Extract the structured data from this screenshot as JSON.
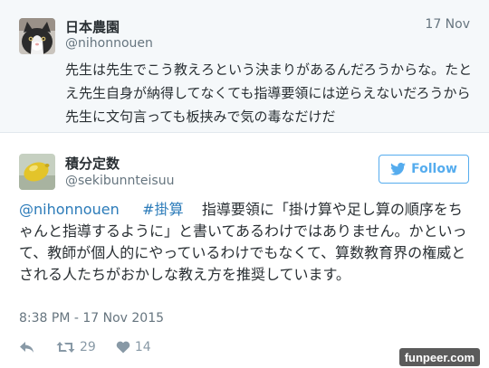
{
  "parent_tweet": {
    "name": "日本農園",
    "handle": "@nihonnouen",
    "date": "17 Nov",
    "text": "先生は先生でこう教えろという決まりがあるんだろうからな。たとえ先生自身が納得してなくても指導要領には逆らえないだろうから先生に文句言っても板挟みで気の毒なだけだ"
  },
  "main_tweet": {
    "name": "積分定数",
    "handle": "@sekibunnteisuu",
    "follow_label": "Follow",
    "mention": "@nihonnouen",
    "hashtag": "#掛算",
    "text": "指導要領に「掛け算や足し算の順序をちゃんと指導するように」と書いてあるわけではありません。かといって、教師が個人的にやっているわけでもなくて、算数教育界の権威とされる人たちがおかしな教え方を推奨しています。",
    "timestamp": "8:38 PM - 17 Nov 2015",
    "retweets": "29",
    "likes": "14"
  },
  "watermark": "funpeer.com",
  "colors": {
    "link": "#2b7bb9",
    "follow": "#55acee",
    "muted": "#66757f",
    "parent_bg": "#f5f8fa"
  },
  "icons": [
    "cat-avatar",
    "bird-logo",
    "reply-icon",
    "retweet-icon",
    "heart-icon",
    "lemon-avatar"
  ]
}
